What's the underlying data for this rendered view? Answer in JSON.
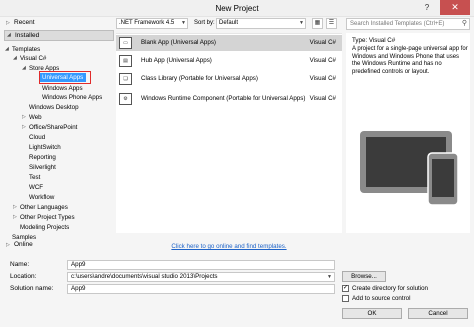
{
  "window": {
    "title": "New Project",
    "help_glyph": "?",
    "close_glyph": "✕"
  },
  "left_pane": {
    "recent": "Recent",
    "installed": "Installed",
    "online": "Online",
    "tree": {
      "templates": "Templates",
      "visual_csharp": "Visual C#",
      "store_apps": "Store Apps",
      "universal_apps": "Universal Apps",
      "windows_apps": "Windows Apps",
      "windows_phone_apps": "Windows Phone Apps",
      "windows_desktop": "Windows Desktop",
      "web": "Web",
      "office_sharepoint": "Office/SharePoint",
      "cloud": "Cloud",
      "lightswitch": "LightSwitch",
      "reporting": "Reporting",
      "silverlight": "Silverlight",
      "test": "Test",
      "wcf": "WCF",
      "workflow": "Workflow",
      "other_languages": "Other Languages",
      "other_project_types": "Other Project Types",
      "modeling_projects": "Modeling Projects",
      "samples": "Samples"
    }
  },
  "filter_bar": {
    "framework": ".NET Framework 4.5",
    "sort_label": "Sort by:",
    "sort_value": "Default"
  },
  "search": {
    "placeholder": "Search Installed Templates (Ctrl+E)"
  },
  "templates": [
    {
      "name": "Blank App (Universal Apps)",
      "lang": "Visual C#"
    },
    {
      "name": "Hub App (Universal Apps)",
      "lang": "Visual C#"
    },
    {
      "name": "Class Library (Portable for Universal Apps)",
      "lang": "Visual C#"
    },
    {
      "name": "Windows Runtime Component (Portable for Universal Apps)",
      "lang": "Visual C#"
    }
  ],
  "details": {
    "type_line": "Type: Visual C#",
    "description": "A project for a single-page universal app for Windows and Windows Phone that uses the Windows Runtime and has no predefined controls or layout."
  },
  "online_link": "Click here to go online and find templates.",
  "form": {
    "name_label": "Name:",
    "name_value": "App9",
    "location_label": "Location:",
    "location_value": "c:\\users\\andre\\documents\\visual studio 2013\\Projects",
    "solution_label": "Solution name:",
    "solution_value": "App9",
    "browse_label": "Browse...",
    "create_dir_label": "Create directory for solution",
    "add_source_label": "Add to source control",
    "ok_label": "OK",
    "cancel_label": "Cancel"
  },
  "colors": {
    "selection": "#3399ff",
    "highlight_box": "#e02b2b",
    "link": "#1e63c8",
    "close_button": "#c75050"
  },
  "icons": {
    "blank_app": "blank-app-icon",
    "hub_app": "hub-app-icon",
    "class_library": "class-library-icon",
    "runtime_component": "runtime-component-icon",
    "search": "search-icon",
    "close": "close-icon"
  }
}
